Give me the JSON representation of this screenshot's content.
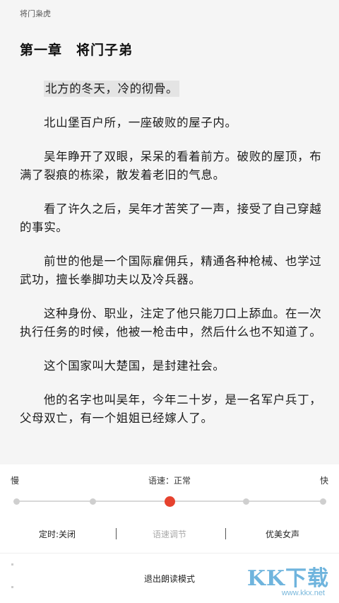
{
  "reader": {
    "book_title": "将门枭虎",
    "chapter_title": "第一章　将门子弟",
    "paragraphs": [
      "北方的冬天，冷的彻骨。",
      "北山堡百户所，一座破败的屋子内。",
      "吴年睁开了双眼，呆呆的看着前方。破败的屋顶，布满了裂痕的栋梁，散发着老旧的气息。",
      "看了许久之后，吴年才苦笑了一声，接受了自己穿越的事实。",
      "前世的他是一个国际雇佣兵，精通各种枪械、也学过武功，擅长拳脚功夫以及冷兵器。",
      "这种身份、职业，注定了他只能刀口上舔血。在一次执行任务的时候，他被一枪击中，然后什么也不知道了。",
      "这个国家叫大楚国，是封建社会。",
      "他的名字也叫吴年，今年二十岁，是一名军户兵丁，父母双亡，有一个姐姐已经嫁人了。"
    ]
  },
  "tts_panel": {
    "slow_label": "慢",
    "fast_label": "快",
    "speed_label": "语速：正常",
    "speed_steps": 5,
    "selected_step_index": 2,
    "timer_label": "定时:关闭",
    "speed_adjust_label": "语速调节",
    "voice_label": "优美女声",
    "exit_label": "退出朗读模式",
    "accent_color": "#e6422e"
  },
  "watermark": {
    "brand": "KK下载",
    "url": "www.kkx.net"
  }
}
